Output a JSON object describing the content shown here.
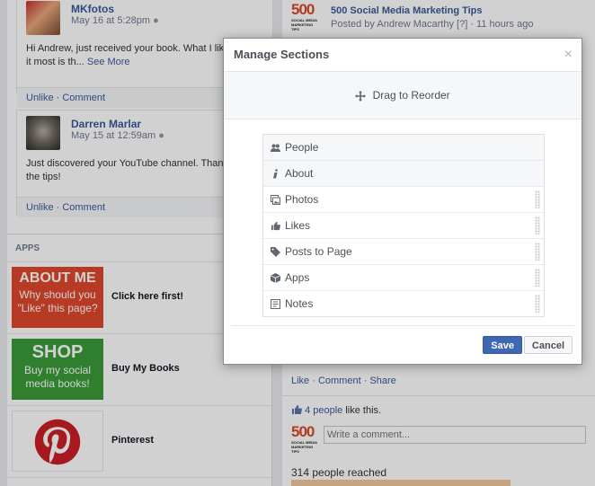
{
  "left": {
    "comments": [
      {
        "name": "MKfotos",
        "date": "May 16 at 5:28pm",
        "body": "Hi Andrew, just received your book. What I like about it most is th... ",
        "see_more": "See More",
        "actions": "Unlike · Comment"
      },
      {
        "name": "Darren Marlar",
        "date": "May 15 at 12:59am",
        "body": "Just discovered your YouTube channel. Thanks for the tips!",
        "actions": "Unlike · Comment"
      }
    ],
    "apps_heading": "APPS",
    "apps": [
      {
        "label": "Click here first!",
        "thumb_title": "ABOUT ME",
        "thumb_sub": "Why should you \"Like\" this page?",
        "color": "#e0492c"
      },
      {
        "label": "Buy My Books",
        "thumb_title": "SHOP",
        "thumb_sub": "Buy my social media books!",
        "color": "#3a9b3a"
      },
      {
        "label": "Pinterest",
        "color": "#cb2027"
      }
    ]
  },
  "right": {
    "post_title": "500 Social Media Marketing Tips",
    "post_by": "Posted by Andrew Macarthy",
    "post_meta": "[?] · 11 hours ago",
    "logo_num": "500",
    "logo_sub": "SOCIAL MEDIA MARKETING TIPS",
    "actions": "Like · Comment · Share",
    "likes_count": "4 people",
    "likes_suffix": "like this.",
    "comment_placeholder": "Write a comment...",
    "reached": "314 people reached"
  },
  "dialog": {
    "title": "Manage Sections",
    "close": "×",
    "drag_label": "Drag to Reorder",
    "sections": [
      {
        "label": "People",
        "icon": "people-icon",
        "fixed": true
      },
      {
        "label": "About",
        "icon": "info-icon",
        "fixed": true
      },
      {
        "label": "Photos",
        "icon": "photos-icon",
        "fixed": false
      },
      {
        "label": "Likes",
        "icon": "thumbs-up-icon",
        "fixed": false
      },
      {
        "label": "Posts to Page",
        "icon": "tag-icon",
        "fixed": false
      },
      {
        "label": "Apps",
        "icon": "cube-icon",
        "fixed": false
      },
      {
        "label": "Notes",
        "icon": "notes-icon",
        "fixed": false
      }
    ],
    "save": "Save",
    "cancel": "Cancel"
  }
}
